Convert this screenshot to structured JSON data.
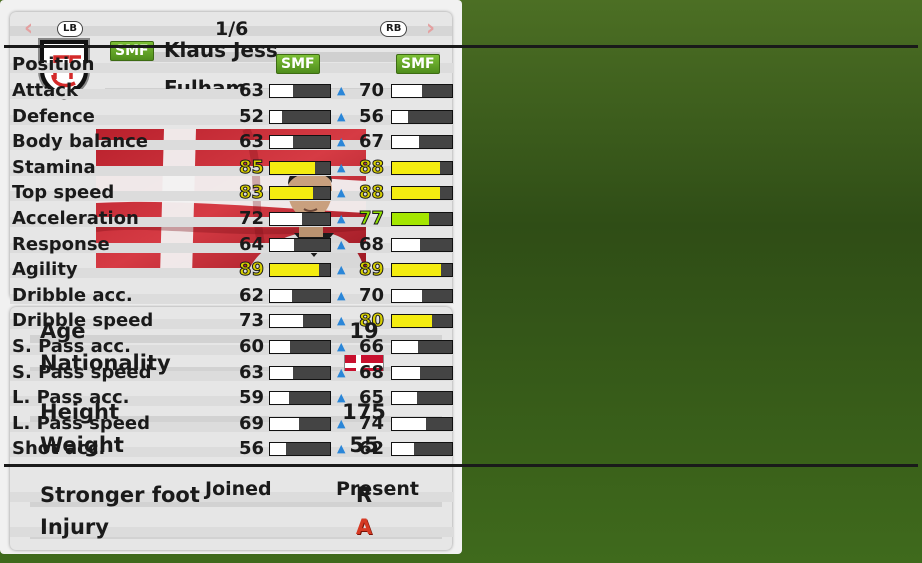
{
  "player": {
    "position_badge": "SMF",
    "name": "Klaus Jess",
    "club": "Fulham"
  },
  "info": {
    "age_label": "Age",
    "age": "19",
    "nationality_label": "Nationality",
    "height_label": "Height",
    "height": "175",
    "weight_label": "Weight",
    "weight": "55",
    "foot_label": "Stronger foot",
    "foot": "R",
    "injury_label": "Injury",
    "injury": "A"
  },
  "nav": {
    "left_button": "LB",
    "right_button": "RB",
    "page": "1/6"
  },
  "stats": {
    "position_label": "Position",
    "joined_position": "SMF",
    "present_position": "SMF",
    "rows": [
      {
        "label": "Attack",
        "joined": "63",
        "present": "70",
        "joined_style": "normal",
        "present_style": "normal"
      },
      {
        "label": "Defence",
        "joined": "52",
        "present": "56",
        "joined_style": "normal",
        "present_style": "normal"
      },
      {
        "label": "Body balance",
        "joined": "63",
        "present": "67",
        "joined_style": "normal",
        "present_style": "normal"
      },
      {
        "label": "Stamina",
        "joined": "85",
        "present": "88",
        "joined_style": "yellow",
        "present_style": "yellow"
      },
      {
        "label": "Top speed",
        "joined": "83",
        "present": "88",
        "joined_style": "yellow",
        "present_style": "yellow"
      },
      {
        "label": "Acceleration",
        "joined": "72",
        "present": "77",
        "joined_style": "normal",
        "present_style": "green"
      },
      {
        "label": "Response",
        "joined": "64",
        "present": "68",
        "joined_style": "normal",
        "present_style": "normal"
      },
      {
        "label": "Agility",
        "joined": "89",
        "present": "89",
        "joined_style": "yellow",
        "present_style": "yellow"
      },
      {
        "label": "Dribble acc.",
        "joined": "62",
        "present": "70",
        "joined_style": "normal",
        "present_style": "normal"
      },
      {
        "label": "Dribble speed",
        "joined": "73",
        "present": "80",
        "joined_style": "normal",
        "present_style": "yellow"
      },
      {
        "label": "S. Pass acc.",
        "joined": "60",
        "present": "66",
        "joined_style": "normal",
        "present_style": "normal"
      },
      {
        "label": "S. Pass speed",
        "joined": "63",
        "present": "68",
        "joined_style": "normal",
        "present_style": "normal"
      },
      {
        "label": "L. Pass acc.",
        "joined": "59",
        "present": "65",
        "joined_style": "normal",
        "present_style": "normal"
      },
      {
        "label": "L. Pass speed",
        "joined": "69",
        "present": "74",
        "joined_style": "normal",
        "present_style": "normal"
      },
      {
        "label": "Shot acc.",
        "joined": "56",
        "present": "62",
        "joined_style": "normal",
        "present_style": "normal"
      }
    ],
    "joined_label": "Joined",
    "present_label": "Present"
  },
  "colors": {
    "badge_green": "#5e9e22",
    "high_yellow": "#f4ec10",
    "mid_green": "#a4e600",
    "arrow_blue": "#2a86d8",
    "injury_red": "#d63a24"
  }
}
